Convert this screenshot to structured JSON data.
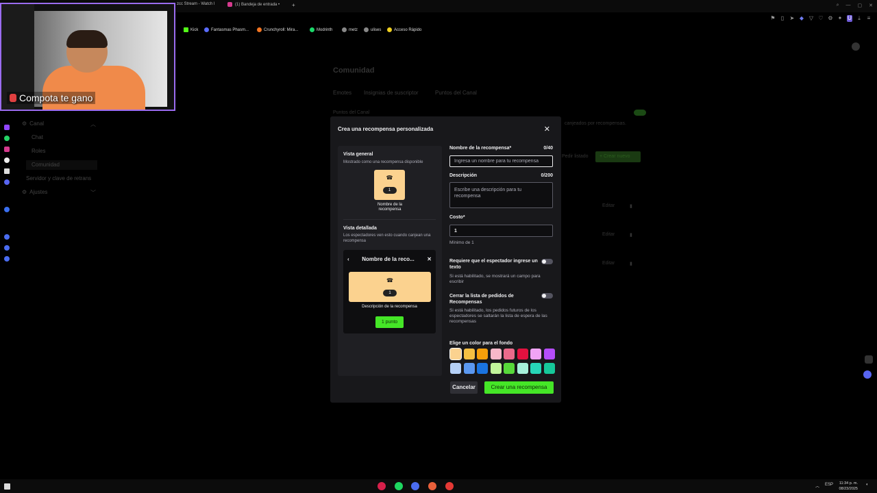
{
  "browser": {
    "tabs": [
      {
        "label": "zcc Stream - Watch l"
      },
      {
        "label": "(1) Bandeja de entrada •"
      }
    ],
    "new_tab": "+",
    "bookmarks": [
      {
        "label": "Kick"
      },
      {
        "label": "Fantasmas Phasm..."
      },
      {
        "label": "Crunchyroll: Mira..."
      },
      {
        "label": "Modrinth"
      },
      {
        "label": "metz"
      },
      {
        "label": "ulises"
      },
      {
        "label": "Acceso Rápido"
      }
    ]
  },
  "webcam": {
    "caption": "Compota te gano"
  },
  "sidebar": {
    "items": [
      {
        "label": "Canal"
      },
      {
        "label": "Chat"
      },
      {
        "label": "Roles"
      },
      {
        "label": "Comunidad"
      },
      {
        "label": "Servidor y clave de retrans"
      },
      {
        "label": "Ajustes"
      }
    ]
  },
  "background_page": {
    "title": "Comunidad",
    "tabs": [
      {
        "label": "Emotes"
      },
      {
        "label": "Insignias de suscriptor"
      },
      {
        "label": "Puntos del Canal"
      }
    ],
    "section_label": "Puntos del Canal",
    "note": "canjeados por recompensas.",
    "order_button": "Pedir listado",
    "create_button": "+ Crear nuevo",
    "edit_label": "Editar"
  },
  "modal": {
    "title": "Crea una recompensa personalizada",
    "close_label": "✕",
    "preview": {
      "general_heading": "Vista general",
      "general_sub": "Mostrado como una recompensa disponible",
      "tile_cost": "1",
      "tile_label": "Nombre de la recompensa",
      "detail_heading": "Vista detallada",
      "detail_sub": "Los espectadores ven esto cuando canjean una recompensa",
      "detail_title": "Nombre de la reco...",
      "detail_cost": "1",
      "detail_description": "Descripción de la recompensa",
      "points_button": "1 punto"
    },
    "form": {
      "name_label": "Nombre de la recompensa*",
      "name_count": "0/40",
      "name_placeholder": "Ingresa un nombre para tu recompensa",
      "description_label": "Descripción",
      "description_count": "0/200",
      "description_placeholder": "Escribe una descripción para tu recompensa",
      "cost_label": "Costo*",
      "cost_value": "1",
      "cost_help": "Mínimo de 1",
      "require_text_label": "Requiere que el espectador ingrese un texto",
      "require_text_help": "Si está habilitado, se mostrará un campo para escribir",
      "close_queue_label": "Cerrar la lista de pedidos de Recompensas",
      "close_queue_help": "Si está habilitado, los pedidos futuros de los espectadores se saltarán la lista de espera de las recompensas",
      "color_label": "Elige un color para el fondo",
      "colors": [
        "#fbd28f",
        "#f5c043",
        "#f59f0a",
        "#f9b8c9",
        "#ec6a8b",
        "#e2113f",
        "#f1a4f5",
        "#b54dfa",
        "#b5d0f7",
        "#5b98f0",
        "#1a73e0",
        "#c1f59a",
        "#57d93a",
        "#a6f0da",
        "#27d6b7",
        "#16c99a"
      ],
      "selected_color": "#fbd28f"
    },
    "cancel_button": "Cancelar",
    "create_button": "Crear una recompensa"
  },
  "taskbar": {
    "lang": "ESP",
    "time": "11:34 p. m.",
    "date": "08/23/2025"
  }
}
